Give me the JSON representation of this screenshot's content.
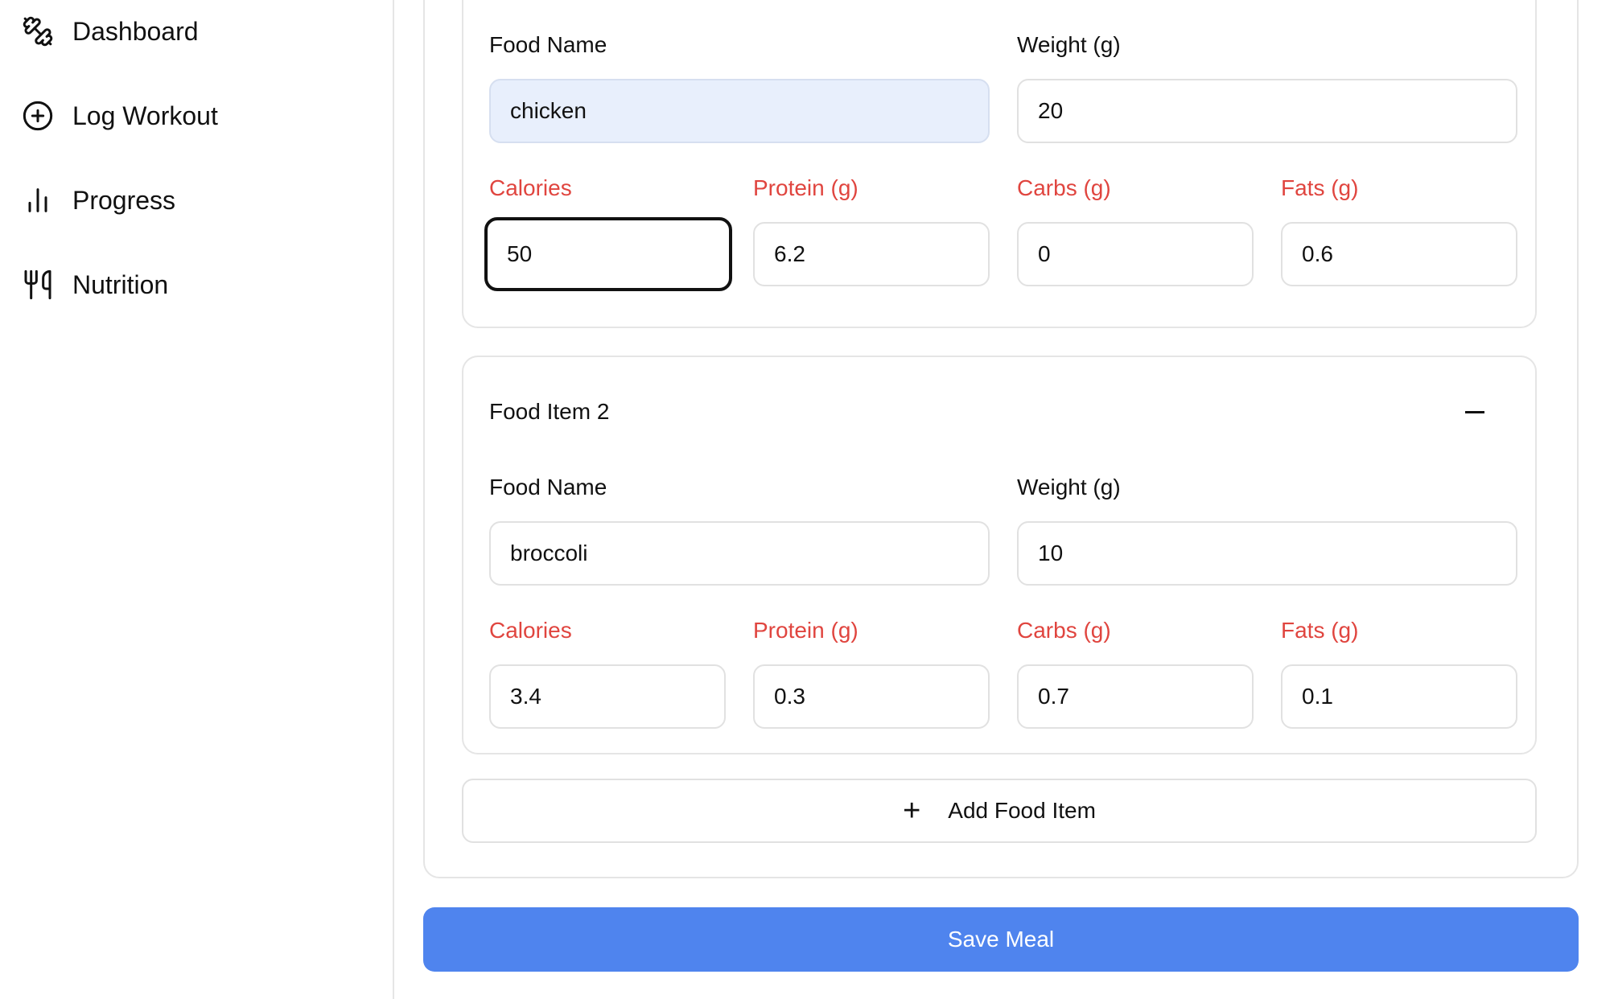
{
  "sidebar": {
    "items": [
      {
        "label": "Dashboard",
        "icon": "dumbbell-icon"
      },
      {
        "label": "Log Workout",
        "icon": "plus-circle-icon"
      },
      {
        "label": "Progress",
        "icon": "bar-chart-icon"
      },
      {
        "label": "Nutrition",
        "icon": "utensils-icon"
      }
    ]
  },
  "labels": {
    "food_name": "Food Name",
    "weight": "Weight (g)",
    "calories": "Calories",
    "protein": "Protein (g)",
    "carbs": "Carbs (g)",
    "fats": "Fats (g)"
  },
  "food_items": [
    {
      "food_name": "chicken",
      "weight": "20",
      "calories": "50",
      "protein": "6.2",
      "carbs": "0",
      "fats": "0.6"
    },
    {
      "title": "Food Item 2",
      "food_name": "broccoli",
      "weight": "10",
      "calories": "3.4",
      "protein": "0.3",
      "carbs": "0.7",
      "fats": "0.1"
    }
  ],
  "add_food_label": "Add Food Item",
  "save_label": "Save Meal",
  "colors": {
    "accent": "#4f84ee",
    "macro_label": "#e0453f",
    "autofill_bg": "#e8effc"
  }
}
